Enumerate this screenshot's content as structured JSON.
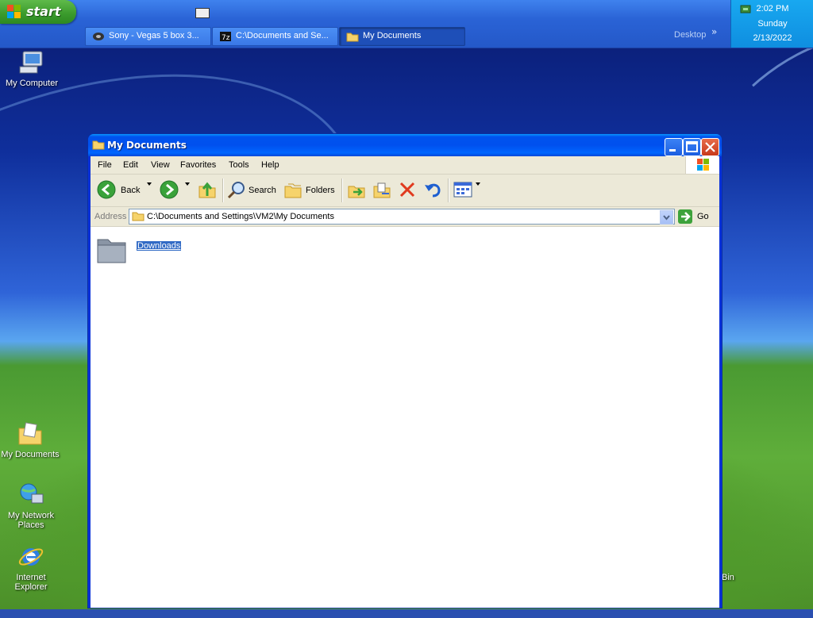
{
  "taskbar": {
    "start_label": "start",
    "tasks": [
      {
        "label": "Sony - Vegas 5 box 3...",
        "active": false
      },
      {
        "label": "C:\\Documents and Se...",
        "active": false
      },
      {
        "label": "My Documents",
        "active": true
      }
    ],
    "desktop_link": "Desktop",
    "chevron": "»",
    "clock": {
      "time": "2:02 PM",
      "day": "Sunday",
      "date": "2/13/2022"
    }
  },
  "desktop_icons": {
    "my_computer": "My Computer",
    "my_documents": "My Documents",
    "network_1": "My Network",
    "network_2": "Places",
    "ie_1": "Internet",
    "ie_2": "Explorer",
    "recycle_partial": "Bin"
  },
  "window": {
    "title": "My Documents",
    "menu": [
      "File",
      "Edit",
      "View",
      "Favorites",
      "Tools",
      "Help"
    ],
    "toolbar": {
      "back": "Back",
      "search": "Search",
      "folders": "Folders"
    },
    "address": {
      "label": "Address",
      "value": "C:\\Documents and Settings\\VM2\\My Documents",
      "go": "Go"
    },
    "items": [
      {
        "name": "Downloads",
        "selected": true
      }
    ]
  },
  "colors": {
    "title_blue": "#0054e3",
    "taskbar_blue": "#245edb",
    "start_green": "#3a9a2c",
    "selection": "#316ac5"
  }
}
